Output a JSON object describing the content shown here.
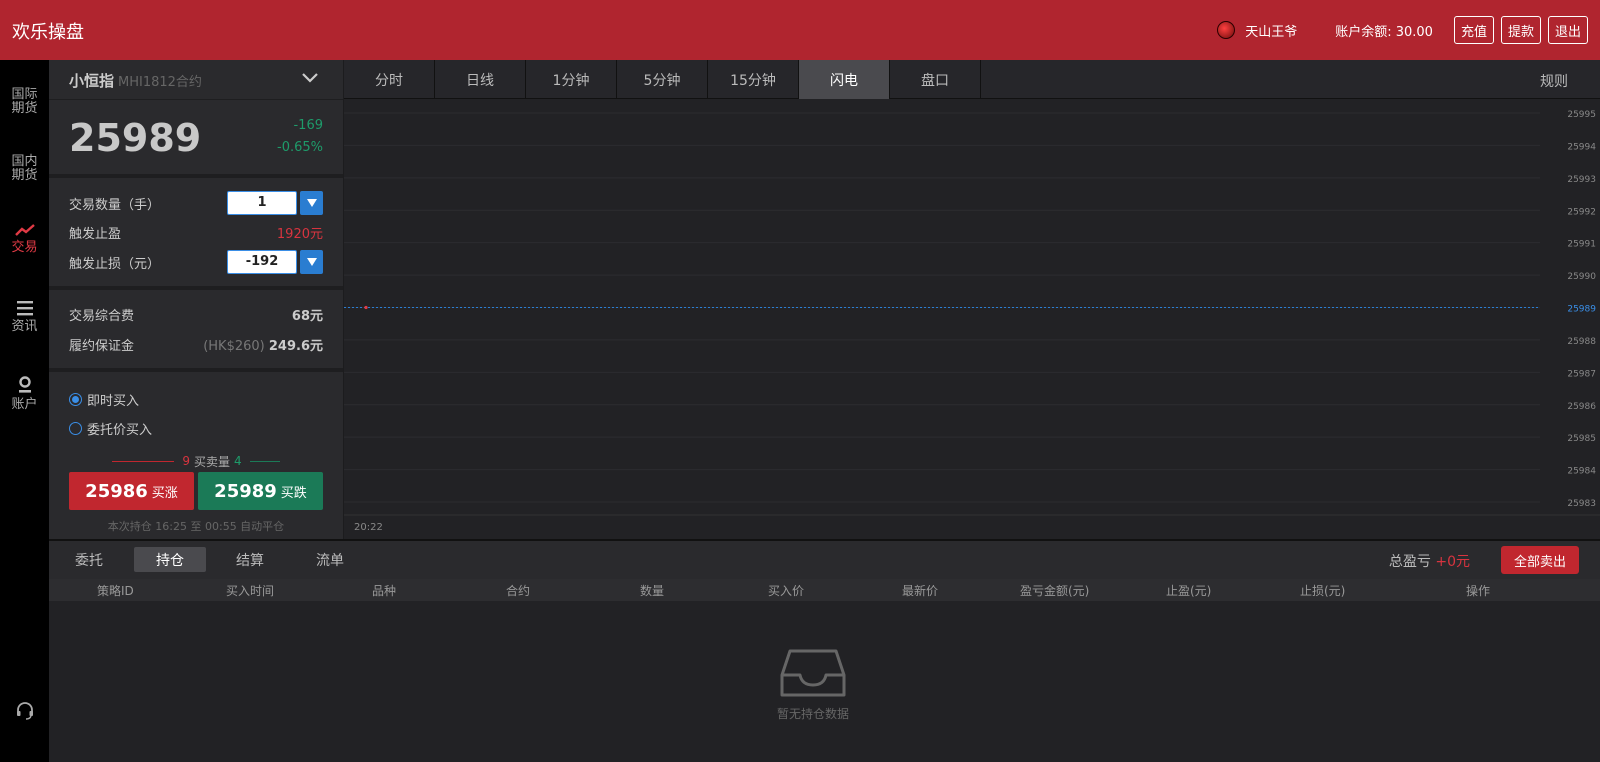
{
  "header": {
    "brand": "欢乐操盘",
    "user_name": "天山王爷",
    "balance_label": "账户余额: 30.00",
    "buttons": [
      "充值",
      "提款",
      "退出"
    ]
  },
  "nav": {
    "items": [
      {
        "label": "国际期货",
        "icon": "",
        "active": false
      },
      {
        "label": "国内期货",
        "icon": "",
        "active": false
      },
      {
        "label": "交易",
        "icon": "trend-icon",
        "active": true
      },
      {
        "label": "资讯",
        "icon": "list-icon",
        "active": false
      },
      {
        "label": "账户",
        "icon": "user-icon",
        "active": false
      }
    ],
    "support_icon": "headset-icon"
  },
  "panel": {
    "symbol_name": "小恒指",
    "symbol_code": "MHI1812合约",
    "price": "25989",
    "change": "-169",
    "change_pct": "-0.65%",
    "qty_label": "交易数量（手）",
    "qty_value": "1",
    "tp_label": "触发止盈",
    "tp_value": "1920元",
    "sl_label": "触发止损（元）",
    "sl_value": "-192",
    "fee_label": "交易综合费",
    "fee_value": "68元",
    "margin_label": "履约保证金",
    "margin_hk": "(HK$260)",
    "margin_value": "249.6元",
    "order_types": [
      {
        "label": "即时买入",
        "selected": true
      },
      {
        "label": "委托价买入",
        "selected": false
      }
    ],
    "buy_count": "9",
    "volume_label": "买卖量",
    "sell_count": "4",
    "buy_up_price": "25986",
    "buy_up_label": "买涨",
    "buy_down_price": "25989",
    "buy_down_label": "买跌",
    "hold_note": "本次持仓 16:25 至 00:55 自动平仓",
    "colors": {
      "up": "#c1272f",
      "down": "#1b7a57"
    }
  },
  "chart_tabs": [
    "分时",
    "日线",
    "1分钟",
    "5分钟",
    "15分钟",
    "闪电",
    "盘口"
  ],
  "chart_active_tab": 5,
  "rule_label": "规则",
  "chart_data": {
    "type": "line",
    "y_ticks": [
      "25995",
      "25994",
      "25993",
      "25992",
      "25991",
      "25990",
      "25989",
      "25988",
      "25987",
      "25986",
      "25985",
      "25984",
      "25983"
    ],
    "ylim": [
      25983,
      25995
    ],
    "current_price": 25989,
    "x_label": "20:22",
    "series": [
      {
        "values": [
          25989
        ]
      }
    ],
    "grid": true
  },
  "bottom": {
    "tabs": [
      "委托",
      "持仓",
      "结算",
      "流单"
    ],
    "active_tab": 1,
    "pnl_label": "总盈亏",
    "pnl_value": "+0元",
    "sell_all": "全部卖出",
    "columns": [
      "策略ID",
      "买入时间",
      "品种",
      "合约",
      "数量",
      "买入价",
      "最新价",
      "盈亏金额(元)",
      "止盈(元)",
      "止损(元)",
      "操作"
    ],
    "empty_icon": "inbox-icon",
    "empty_text": "暂无持仓数据"
  }
}
